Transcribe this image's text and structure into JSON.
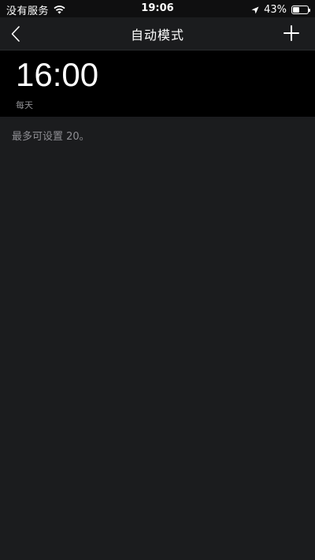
{
  "status_bar": {
    "carrier": "没有服务",
    "time": "19:06",
    "battery_percent": "43%",
    "battery_level": 0.43,
    "icons": [
      "wifi-icon",
      "location-arrow-icon",
      "battery-icon"
    ]
  },
  "header": {
    "title": "自动模式",
    "back_icon": "chevron-left-icon",
    "add_icon": "plus-icon"
  },
  "schedules": [
    {
      "time": "16:00",
      "repeat": "每天"
    }
  ],
  "hint": "最多可设置 20。",
  "colors": {
    "background": "#1b1c1e",
    "row_background": "#000000",
    "secondary_text": "#8e8e93"
  }
}
